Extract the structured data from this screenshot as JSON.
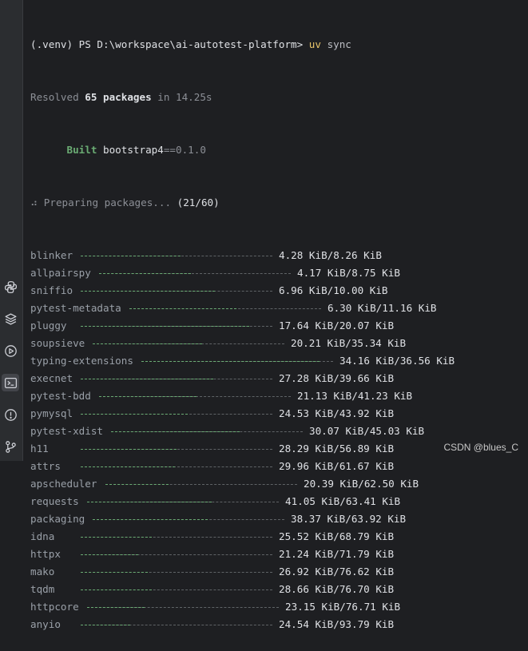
{
  "header": {
    "prompt_prefix": "(.venv) PS D:\\workspace\\ai-autotest-platform>",
    "command_uv": "uv",
    "command_sync": "sync",
    "resolved_prefix": "Resolved",
    "resolved_count": "65 packages",
    "resolved_suffix": "in 14.25s",
    "built_label": "Built",
    "built_pkg": "bootstrap4",
    "built_version": "==0.1.0",
    "preparing_label": "⠴ Preparing packages...",
    "preparing_count": "(21/60)"
  },
  "packages": [
    {
      "name": "blinker",
      "size": "4.28 KiB/8.26 KiB",
      "progress": 0.52
    },
    {
      "name": "allpairspy",
      "size": "4.17 KiB/8.75 KiB",
      "progress": 0.48
    },
    {
      "name": "sniffio",
      "size": "6.96 KiB/10.00 KiB",
      "progress": 0.7
    },
    {
      "name": "pytest-metadata",
      "size": "6.30 KiB/11.16 KiB",
      "progress": 0.56
    },
    {
      "name": "pluggy",
      "size": "17.64 KiB/20.07 KiB",
      "progress": 0.88
    },
    {
      "name": "soupsieve",
      "size": "20.21 KiB/35.34 KiB",
      "progress": 0.57
    },
    {
      "name": "typing-extensions",
      "size": "34.16 KiB/36.56 KiB",
      "progress": 0.93
    },
    {
      "name": "execnet",
      "size": "27.28 KiB/39.66 KiB",
      "progress": 0.69
    },
    {
      "name": "pytest-bdd",
      "size": "21.13 KiB/41.23 KiB",
      "progress": 0.51
    },
    {
      "name": "pymysql",
      "size": "24.53 KiB/43.92 KiB",
      "progress": 0.56
    },
    {
      "name": "pytest-xdist",
      "size": "30.07 KiB/45.03 KiB",
      "progress": 0.67
    },
    {
      "name": "h11",
      "size": "28.29 KiB/56.89 KiB",
      "progress": 0.5
    },
    {
      "name": "attrs",
      "size": "29.96 KiB/61.67 KiB",
      "progress": 0.49
    },
    {
      "name": "apscheduler",
      "size": "20.39 KiB/62.50 KiB",
      "progress": 0.33
    },
    {
      "name": "requests",
      "size": "41.05 KiB/63.41 KiB",
      "progress": 0.65
    },
    {
      "name": "packaging",
      "size": "38.37 KiB/63.92 KiB",
      "progress": 0.6
    },
    {
      "name": "idna",
      "size": "25.52 KiB/68.79 KiB",
      "progress": 0.37
    },
    {
      "name": "httpx",
      "size": "21.24 KiB/71.79 KiB",
      "progress": 0.3
    },
    {
      "name": "mako",
      "size": "26.92 KiB/76.62 KiB",
      "progress": 0.35
    },
    {
      "name": "tqdm",
      "size": "28.66 KiB/76.70 KiB",
      "progress": 0.37
    },
    {
      "name": "httpcore",
      "size": "23.15 KiB/76.71 KiB",
      "progress": 0.3
    },
    {
      "name": "anyio",
      "size": "24.54 KiB/93.79 KiB",
      "progress": 0.26
    }
  ],
  "sidebar_icons": [
    "python-icon",
    "layers-icon",
    "run-icon",
    "terminal-icon",
    "problems-icon",
    "git-icon"
  ],
  "watermark": "CSDN @blues_C"
}
